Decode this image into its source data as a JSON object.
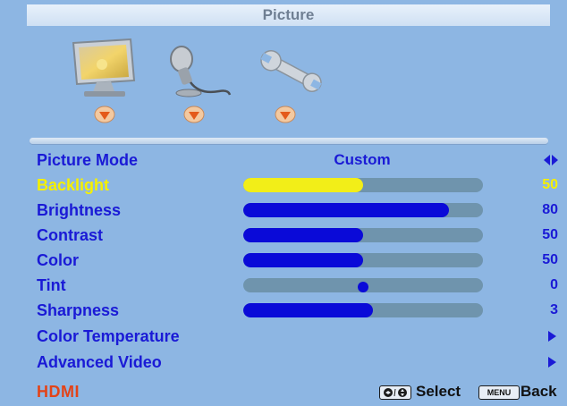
{
  "menu": {
    "title": "Picture",
    "tabs": [
      {
        "name": "picture",
        "icon": "monitor-icon"
      },
      {
        "name": "audio",
        "icon": "microphone-icon"
      },
      {
        "name": "setup",
        "icon": "wrench-icon"
      }
    ]
  },
  "settings": [
    {
      "label": "Picture Mode",
      "value": "Custom",
      "control": "select"
    },
    {
      "label": "Backlight",
      "value": "50",
      "level": 0.5,
      "control": "slider",
      "selected": true
    },
    {
      "label": "Brightness",
      "value": "80",
      "level": 0.86,
      "control": "slider"
    },
    {
      "label": "Contrast",
      "value": "50",
      "level": 0.5,
      "control": "slider"
    },
    {
      "label": "Color",
      "value": "50",
      "level": 0.5,
      "control": "slider"
    },
    {
      "label": "Tint",
      "value": "0",
      "level": 0.5,
      "control": "center-slider"
    },
    {
      "label": "Sharpness",
      "value": "3",
      "level": 0.54,
      "control": "slider"
    },
    {
      "label": "Color Temperature",
      "control": "submenu"
    },
    {
      "label": "Advanced Video",
      "control": "submenu"
    }
  ],
  "footer": {
    "source": "HDMI",
    "select_label": "Select",
    "menu_key": "MENU",
    "back_label": "Back"
  },
  "colors": {
    "background": "#8db6e3",
    "label": "#1a1ad6",
    "selected": "#f5f000",
    "fill": "#0a0ad8",
    "track": "#6f94ad",
    "source": "#e34318"
  }
}
